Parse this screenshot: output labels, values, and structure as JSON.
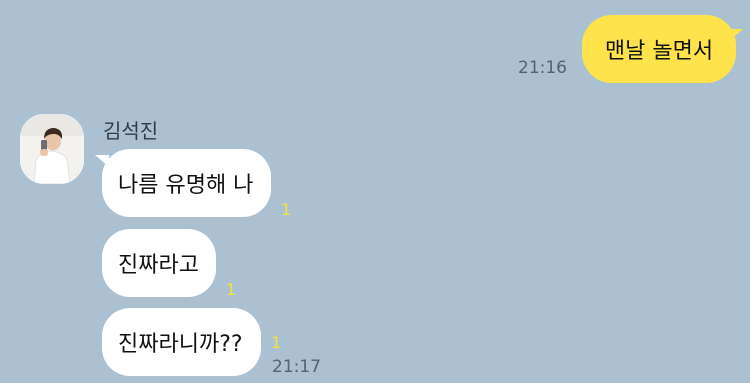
{
  "messages_out": [
    {
      "text": "맨날 놀면서",
      "time": "21:16"
    }
  ],
  "sender": {
    "name": "김석진",
    "avatar_icon": "profile-photo"
  },
  "messages_in": [
    {
      "text": "나름 유명해 나",
      "unread": "1"
    },
    {
      "text": "진짜라고",
      "unread": "1"
    },
    {
      "text": "진짜라니까??",
      "unread": "1",
      "time": "21:17"
    }
  ],
  "colors": {
    "background": "#abc1d1",
    "outgoing_bubble": "#fee34b",
    "incoming_bubble": "#ffffff",
    "unread_count": "#f5e13a"
  }
}
